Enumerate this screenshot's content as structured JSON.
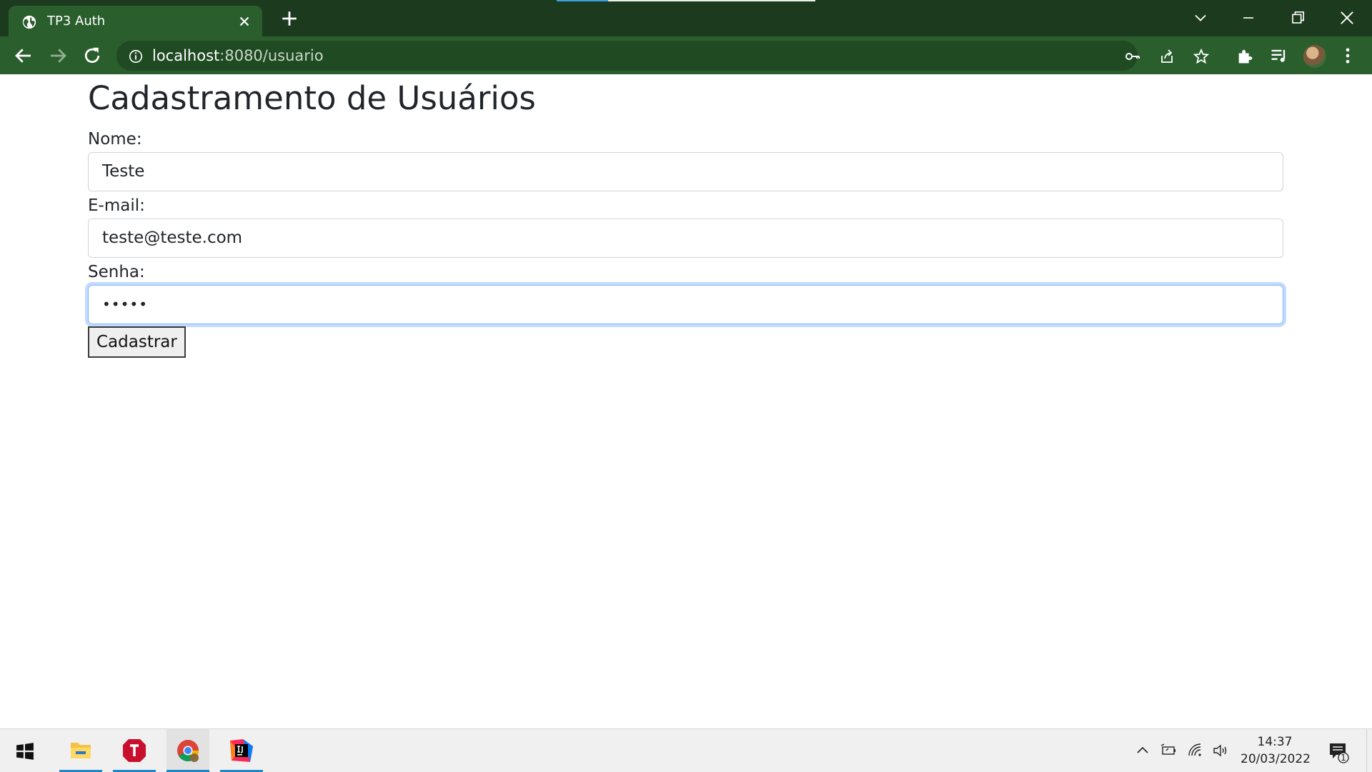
{
  "browser": {
    "tab_title": "TP3 Auth",
    "url_host": "localhost",
    "url_path": ":8080/usuario"
  },
  "page": {
    "heading": "Cadastramento de Usuários",
    "fields": [
      {
        "label": "Nome:",
        "value": "Teste"
      },
      {
        "label": "E-mail:",
        "value": "teste@teste.com"
      },
      {
        "label": "Senha:",
        "value": "•••••"
      }
    ],
    "submit_label": "Cadastrar"
  },
  "taskbar": {
    "apps": [
      "file-explorer",
      "app-t",
      "chrome",
      "intellij"
    ],
    "time": "14:37",
    "date": "20/03/2022",
    "notification_count": "1"
  },
  "colors": {
    "tabstrip": "#1c3a1e",
    "toolbar": "#2a5e2d",
    "focus_ring": "#86b7fe"
  }
}
